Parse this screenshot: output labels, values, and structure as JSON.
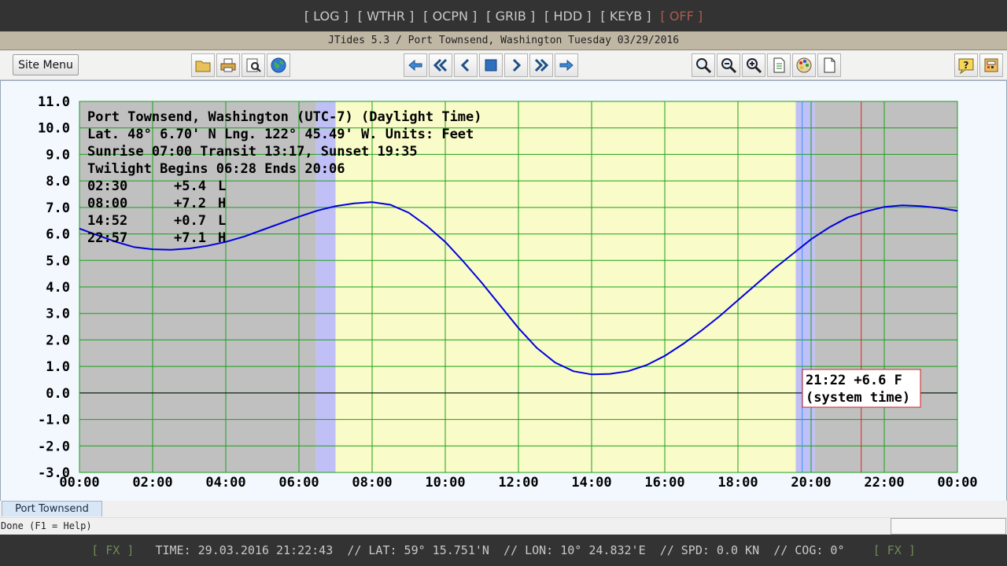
{
  "top_nav": [
    "[ LOG ]",
    "[ WTHR ]",
    "[ OCPN ]",
    "[ GRIB ]",
    "[ HDD ]",
    "[ KEYB ]",
    "[ OFF ]"
  ],
  "window_title": "JTides 5.3 / Port Townsend, Washington Tuesday 03/29/2016",
  "toolbar": {
    "site_menu_label": "Site Menu",
    "file_icons": [
      "folder-icon",
      "printer-icon",
      "print-preview-icon",
      "globe-icon"
    ],
    "nav_icons": [
      "back-arrow-icon",
      "rewind-icon",
      "prev-icon",
      "stop-icon",
      "next-icon",
      "fast-forward-icon",
      "forward-arrow-icon"
    ],
    "view_icons": [
      "search-icon",
      "zoom-out-icon",
      "zoom-in-icon",
      "document-icon",
      "palette-icon",
      "blank-page-icon"
    ],
    "help_icons": [
      "help-icon",
      "calculator-icon"
    ]
  },
  "info": {
    "line1": "Port Townsend, Washington (UTC-7) (Daylight Time)",
    "line2": "Lat. 48° 6.70' N Lng. 122° 45.49' W. Units: Feet",
    "line3": "Sunrise 07:00  Transit 13:17, Sunset 19:35",
    "line4": "Twilight Begins 06:28  Ends 20:06",
    "tides": [
      {
        "time": "02:30",
        "height": "+5.4",
        "type": "L"
      },
      {
        "time": "08:00",
        "height": "+7.2",
        "type": "H"
      },
      {
        "time": "14:52",
        "height": "+0.7",
        "type": "L"
      },
      {
        "time": "22:57",
        "height": "+7.1",
        "type": "H"
      }
    ]
  },
  "tooltip": {
    "line1": "21:22 +6.6 F",
    "line2": "(system time)"
  },
  "chart_data": {
    "type": "line",
    "y_tick_labels": [
      "11.0",
      "10.0",
      "9.0",
      "8.0",
      "7.0",
      "6.0",
      "5.0",
      "4.0",
      "3.0",
      "2.0",
      "1.0",
      "0.0",
      "-1.0",
      "-2.0",
      "-3.0"
    ],
    "x_tick_labels": [
      "00:00",
      "02:00",
      "04:00",
      "06:00",
      "08:00",
      "10:00",
      "12:00",
      "14:00",
      "16:00",
      "18:00",
      "20:00",
      "22:00",
      "00:00"
    ],
    "ylim": [
      -3.0,
      11.0
    ],
    "xlim_hours": [
      0,
      24
    ],
    "grid": true,
    "twilight_begins_h": 6.47,
    "sunrise_h": 7.0,
    "sunset_h": 19.58,
    "twilight_ends_h": 20.1,
    "system_time_h": 21.37,
    "series": [
      {
        "x": [
          0,
          0.5,
          1,
          1.5,
          2,
          2.5,
          3,
          3.5,
          4,
          4.5,
          5,
          5.5,
          6,
          6.5,
          7,
          7.5,
          8,
          8.5,
          9,
          9.5,
          10,
          10.5,
          11,
          11.5,
          12,
          12.5,
          13,
          13.5,
          14,
          14.5,
          15,
          15.5,
          16,
          16.5,
          17,
          17.5,
          18,
          18.5,
          19,
          19.5,
          20,
          20.5,
          21,
          21.5,
          22,
          22.5,
          23,
          23.5,
          24
        ],
        "y": [
          6.2,
          5.95,
          5.7,
          5.5,
          5.42,
          5.4,
          5.45,
          5.55,
          5.7,
          5.9,
          6.15,
          6.4,
          6.65,
          6.88,
          7.05,
          7.15,
          7.2,
          7.1,
          6.8,
          6.3,
          5.7,
          4.95,
          4.15,
          3.3,
          2.45,
          1.7,
          1.15,
          0.82,
          0.7,
          0.72,
          0.82,
          1.05,
          1.4,
          1.85,
          2.35,
          2.9,
          3.5,
          4.1,
          4.7,
          5.25,
          5.8,
          6.25,
          6.62,
          6.85,
          7.02,
          7.08,
          7.05,
          6.98,
          6.87
        ]
      }
    ]
  },
  "tab_label": "Port Townsend",
  "status_text": "Done (F1 = Help)",
  "bottom_bar": {
    "fx_left": "[ FX ]",
    "time": "TIME: 29.03.2016 21:22:43",
    "lat": "// LAT: 59° 15.751'N",
    "lon": "// LON: 10° 24.832'E",
    "spd": "// SPD: 0.0 KN",
    "cog": "// COG: 0°",
    "fx_right": "[ FX ]"
  },
  "colors": {
    "night": "#c0c0c0",
    "twilight": "#c0c0f6",
    "day": "#f9fbc8",
    "grid": "#1aa01a",
    "tide_line": "#0000dd",
    "system_time_line": "#dd2222",
    "sunset_line": "#3399ff"
  }
}
